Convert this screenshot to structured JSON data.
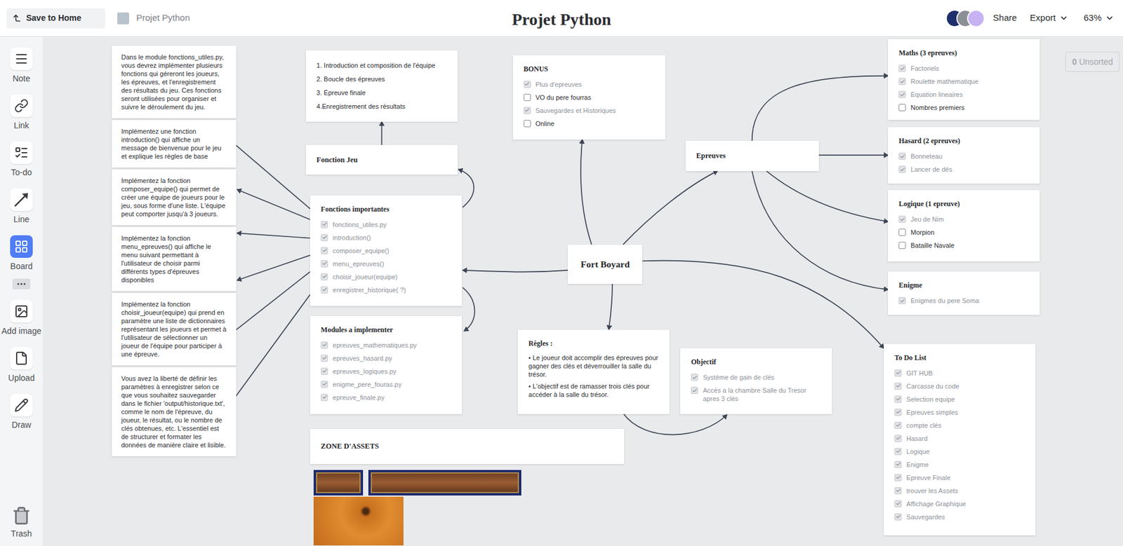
{
  "topbar": {
    "save": "Save to Home",
    "breadcrumb": "Projet Python",
    "title": "Projet Python",
    "share": "Share",
    "export": "Export",
    "zoom": "63%"
  },
  "toolbar": [
    {
      "label": "Note",
      "selected": false
    },
    {
      "label": "Link",
      "selected": false
    },
    {
      "label": "To-do",
      "selected": false
    },
    {
      "label": "Line",
      "selected": false
    },
    {
      "label": "Board",
      "selected": true
    },
    {
      "label": "Add image",
      "selected": false
    },
    {
      "label": "Upload",
      "selected": false
    },
    {
      "label": "Draw",
      "selected": false
    }
  ],
  "trash": "Trash",
  "unsorted": {
    "count": "0",
    "label": "Unsorted"
  },
  "notes": [
    "Dans le module fonctions_utiles.py, vous devrez implémenter plusieurs fonctions qui  géreront les joueurs, les épreuves, et l'enregistrement des résultats du jeu. Ces fonctions seront utilisées pour organiser et suivre le déroulement du jeu.",
    "Implémentez une fonction introduction() qui affiche un message de bienvenue pour le  jeu et explique les règles de base",
    "Implémentez la fonction composer_equipe() qui permet de créer une équipe de joueurs  pour le jeu, sous forme d'une liste. L'équipe peut comporter jusqu'à 3 joueurs.",
    "Implémentez la fonction menu_epreuves() qui affiche le menu suivant permettant à l'utilisateur de choisir parmi différents types d'épreuves disponibles",
    "Implémentez la fonction choisir_joueur(equipe) qui prend en paramètre une liste de dictionnaires représentant les joueurs et permet à l'utilisateur de sélectionner un joueur  de l'équipe pour participer à une épreuve.",
    "Vous avez la liberté de définir les paramètres à enregistrer  selon ce que vous souhaitez sauvegarder dans le fichier 'output/historique.txt', comme  le nom de l'épreuve, du joueur, le résultat, ou le nombre de clés obtenues, etc. L'essentiel  est de structurer et formater les données de manière claire et lisible."
  ],
  "cards": [
    {
      "kind": "list",
      "lines": [
        "1. Introduction et composition de l'équipe",
        "2. Boucle des épreuves",
        "3. Épreuve finale",
        "4.Enregistrement des résultats"
      ]
    },
    {
      "kind": "heading",
      "title": "Fonction Jeu"
    },
    {
      "kind": "todo",
      "title": "Fonctions importantes",
      "items": [
        {
          "text": "fonctions_utiles.py",
          "checked": true
        },
        {
          "text": "introduction()",
          "checked": true
        },
        {
          "text": "composer_equipe()",
          "checked": true
        },
        {
          "text": "menu_epreuves()",
          "checked": true
        },
        {
          "text": "choisir_joueur(equipe)",
          "checked": true
        },
        {
          "text": "enregistrer_historique( ?)",
          "checked": true
        }
      ]
    },
    {
      "kind": "todo",
      "title": "Modules a implementer",
      "items": [
        {
          "text": "epreuves_mathematiques.py",
          "checked": true
        },
        {
          "text": "epreuves_hasard.py",
          "checked": true
        },
        {
          "text": "epreuves_logiques.py",
          "checked": true
        },
        {
          "text": "enigme_pere_fouras.py",
          "checked": true
        },
        {
          "text": "epreuve_finale.py",
          "checked": true
        }
      ]
    },
    {
      "kind": "heading",
      "title": "ZONE D'ASSETS"
    },
    {
      "kind": "todo",
      "title": "BONUS",
      "items": [
        {
          "text": "Plus d'epreuves",
          "checked": true
        },
        {
          "text": "VO du pere fourras",
          "checked": false
        },
        {
          "text": "Sauvegardes et Historiques",
          "checked": true
        },
        {
          "text": "Online",
          "checked": false
        }
      ]
    },
    {
      "kind": "title",
      "title": "Fort Boyard"
    },
    {
      "kind": "rules",
      "title": "Règles :",
      "lines": [
        "• Le joueur doit accomplir des épreuves pour gagner des clés et déverrouiller la salle du trésor.",
        "• L'objectif est de ramasser trois clés pour accéder à la salle du trésor."
      ]
    },
    {
      "kind": "todo",
      "title": "Objectif",
      "items": [
        {
          "text": "Système de gain de clés",
          "checked": true
        },
        {
          "text": "Accès a la chambre Salle du Tresor apres 3 clés",
          "checked": true
        }
      ]
    },
    {
      "kind": "heading",
      "title": "Epreuves"
    },
    {
      "kind": "todo",
      "title": "Maths (3 epreuves)",
      "items": [
        {
          "text": "Factoriels",
          "checked": true
        },
        {
          "text": "Roulette mathematique",
          "checked": true
        },
        {
          "text": "Equation lineaires",
          "checked": true
        },
        {
          "text": "Nombres premiers",
          "checked": false
        }
      ]
    },
    {
      "kind": "todo",
      "title": "Hasard (2 epreuves)",
      "items": [
        {
          "text": "Bonneteau",
          "checked": true
        },
        {
          "text": "Lancer de dés",
          "checked": true
        }
      ]
    },
    {
      "kind": "todo",
      "title": "Logique (1 epreuve)",
      "items": [
        {
          "text": "Jeu de Nim",
          "checked": true
        },
        {
          "text": "Morpion",
          "checked": false
        },
        {
          "text": "Bataille Navale",
          "checked": false
        }
      ]
    },
    {
      "kind": "todo",
      "title": "Enigme",
      "items": [
        {
          "text": "Enigmes du pere Soma",
          "checked": true
        }
      ]
    },
    {
      "kind": "todo",
      "title": "To Do List",
      "items": [
        {
          "text": "GIT HUB",
          "checked": true
        },
        {
          "text": "Carcasse du code",
          "checked": true
        },
        {
          "text": "Selection equipe",
          "checked": true
        },
        {
          "text": "Epreuves simples",
          "checked": true
        },
        {
          "text": "compte clés",
          "checked": true
        },
        {
          "text": "Hasard",
          "checked": true
        },
        {
          "text": "Logique",
          "checked": true
        },
        {
          "text": "Enigme",
          "checked": true
        },
        {
          "text": "Epreuve Finale",
          "checked": true
        },
        {
          "text": "trouver les Assets",
          "checked": true
        },
        {
          "text": "Affichage Graphique",
          "checked": true
        },
        {
          "text": "Sauvegardes",
          "checked": true
        }
      ]
    }
  ]
}
